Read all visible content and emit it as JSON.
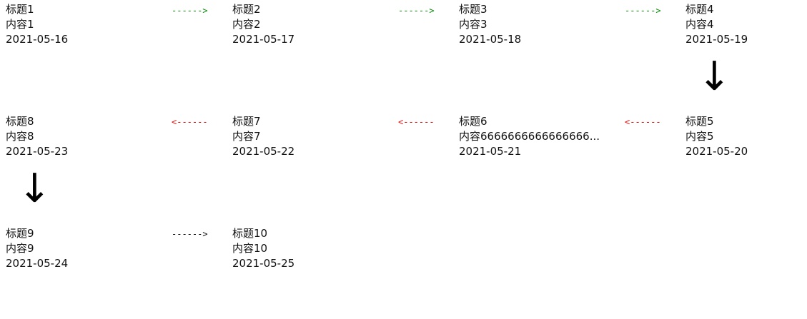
{
  "timeline": {
    "items": [
      {
        "title": "标题1",
        "content": "内容1",
        "date": "2021-05-16"
      },
      {
        "title": "标题2",
        "content": "内容2",
        "date": "2021-05-17"
      },
      {
        "title": "标题3",
        "content": "内容3",
        "date": "2021-05-18"
      },
      {
        "title": "标题4",
        "content": "内容4",
        "date": "2021-05-19"
      },
      {
        "title": "标题5",
        "content": "内容5",
        "date": "2021-05-20"
      },
      {
        "title": "标题6",
        "content": "内容6666666666666666...",
        "date": "2021-05-21"
      },
      {
        "title": "标题7",
        "content": "内容7",
        "date": "2021-05-22"
      },
      {
        "title": "标题8",
        "content": "内容8",
        "date": "2021-05-23"
      },
      {
        "title": "标题9",
        "content": "内容9",
        "date": "2021-05-24"
      },
      {
        "title": "标题10",
        "content": "内容10",
        "date": "2021-05-25"
      }
    ],
    "arrows": {
      "right": "------>",
      "left": "<------",
      "down": "↓"
    },
    "colors": {
      "forward": "#0a8a0a",
      "backward": "#e01010",
      "pending": "#111111",
      "down": "#000000"
    }
  }
}
